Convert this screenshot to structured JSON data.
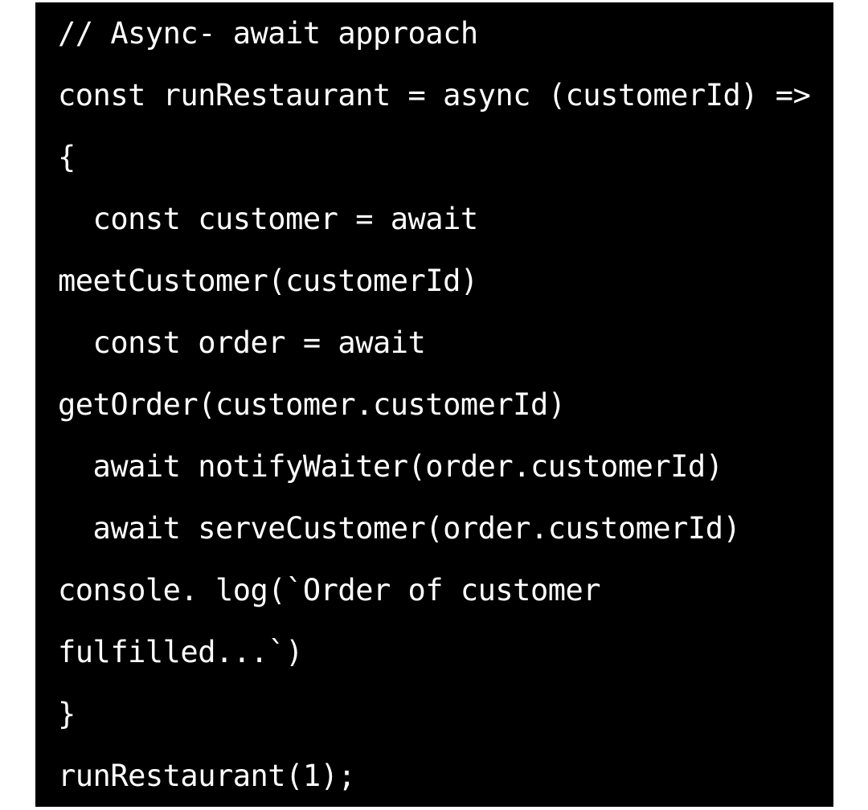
{
  "code": {
    "lines": [
      "// Async- await approach",
      "const runRestaurant = async (customerId) =>",
      "{",
      "  const customer = await",
      "meetCustomer(customerId)",
      "  const order = await",
      "getOrder(customer.customerId)",
      "  await notifyWaiter(order.customerId)",
      "  await serveCustomer(order.customerId)",
      "console. log(`Order of customer",
      "fulfilled...`)",
      "}",
      "runRestaurant(1);"
    ]
  },
  "colors": {
    "background": "#000000",
    "text": "#ffffff",
    "page": "#ffffff"
  }
}
